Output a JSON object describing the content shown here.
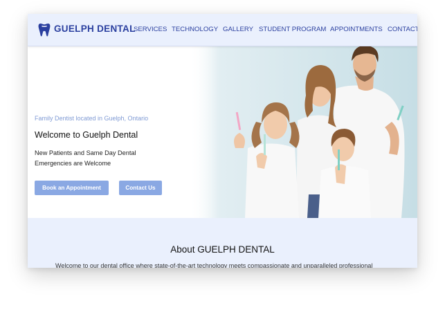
{
  "header": {
    "brand": "GUELPH DENTAL",
    "nav": [
      "SERVICES",
      "TECHNOLOGY",
      "GALLERY",
      "STUDENT PROGRAM",
      "APPOINTMENTS",
      "CONTACT"
    ]
  },
  "hero": {
    "tagline": "Family Dentist located in Guelph, Ontario",
    "title": "Welcome to Guelph Dental",
    "subtitle_line1": "New Patients and Same Day Dental",
    "subtitle_line2": "Emergencies are Welcome",
    "primary_button": "Book an Appointment",
    "secondary_button": "Contact Us"
  },
  "about": {
    "title": "About GUELPH DENTAL",
    "text": "Welcome to our dental office where state-of-the-art technology meets compassionate and unparalleled professional"
  },
  "colors": {
    "brand": "#2a3f9f",
    "nav_bg": "#eaf0fd",
    "button": "#8aa8e3",
    "tagline": "#7f9ad4"
  },
  "icons": {
    "logo": "tooth-icon"
  }
}
